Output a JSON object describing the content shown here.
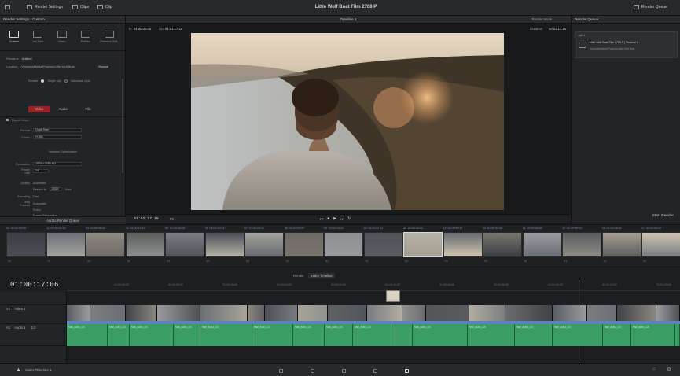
{
  "app": {
    "title": "Little Wolf Boat Film 2768 P",
    "menu": [
      {
        "label": "Render Settings",
        "icon": "render-settings-icon"
      },
      {
        "label": "Clips",
        "icon": "clips-icon"
      },
      {
        "label": "Clip",
        "icon": "inspector-icon"
      }
    ],
    "right_action": "Render Queue"
  },
  "render_settings": {
    "header": "Render Settings - Custom",
    "presets": [
      "Custom",
      "YouTube",
      "Vimeo",
      "ProRes",
      "Premiere XML"
    ],
    "filename_label": "Filename",
    "filename_value": "Untitled",
    "location_label": "Location",
    "location_value": "/Volumes/Media/Projects/Little Wolf Boat",
    "browse_label": "Browse",
    "render_label": "Render",
    "single_clip_label": "Single clip",
    "individual_clips_label": "Individual clips",
    "tabs": [
      "Video",
      "Audio",
      "File"
    ],
    "export_video_label": "Export Video",
    "format_label": "Format",
    "format_value": "QuickTime",
    "codec_label": "Codec",
    "codec_value": "H.264",
    "advanced_label": "Network Optimization",
    "resolution_label": "Resolution",
    "resolution_value": "1920 x 1080 HD",
    "framerate_label": "Frame rate",
    "framerate_value": "24",
    "quality_label": "Quality",
    "quality_auto": "Automatic",
    "quality_restrict": "Restrict to",
    "quality_value": "10000",
    "quality_unit": "Kb/s",
    "encoding_label": "Encoding",
    "encoding_value": "Fast",
    "keyframes_label": "Key Frames",
    "keyframes_auto": "Automatic",
    "keyframes_every": "Every",
    "frame_reordering": "Frame Reordering",
    "render_button": "Add to Render Queue"
  },
  "viewer": {
    "tab": "Timeline 1",
    "in_label": "In",
    "in_value": "01:00:00:00",
    "out_label": "Out",
    "out_value": "01:01:17:15",
    "render_mode": "Render Mode",
    "duration_label": "Duration",
    "duration_value": "00:01:17:15",
    "timecode": "01:02:17:16",
    "zoom": "Fit"
  },
  "render_queue": {
    "header": "Render Queue",
    "job_label": "Job 1",
    "job_title": "Little Wolf Boat Film 2768 P | Timeline 1",
    "job_path": "/Volumes/Media/Projects/Little Wolf Boat",
    "start_button": "Start Render"
  },
  "clips": {
    "items": [
      {
        "num": "01",
        "tc": "01:00:00:00",
        "label": "V1"
      },
      {
        "num": "02",
        "tc": "01:00:04:18",
        "label": "V1"
      },
      {
        "num": "03",
        "tc": "01:00:08:02",
        "label": "V1"
      },
      {
        "num": "04",
        "tc": "01:00:12:10",
        "label": "V1"
      },
      {
        "num": "05",
        "tc": "01:00:16:05",
        "label": "V1"
      },
      {
        "num": "06",
        "tc": "01:00:20:14",
        "label": "V1"
      },
      {
        "num": "07",
        "tc": "01:00:25:01",
        "label": "V1"
      },
      {
        "num": "08",
        "tc": "01:00:29:09",
        "label": "V1"
      },
      {
        "num": "09",
        "tc": "01:00:33:22",
        "label": "V1"
      },
      {
        "num": "10",
        "tc": "01:00:37:11",
        "label": "V1"
      },
      {
        "num": "11",
        "tc": "01:00:42:03",
        "label": "V1"
      },
      {
        "num": "12",
        "tc": "01:00:46:17",
        "label": "V1"
      },
      {
        "num": "13",
        "tc": "01:00:51:00",
        "label": "V1"
      },
      {
        "num": "14",
        "tc": "01:00:55:08",
        "label": "V1"
      },
      {
        "num": "15",
        "tc": "01:00:59:19",
        "label": "V1"
      },
      {
        "num": "16",
        "tc": "01:01:04:02",
        "label": "V1"
      },
      {
        "num": "17",
        "tc": "01:01:08:12",
        "label": "V1"
      }
    ]
  },
  "timeline": {
    "timecode": "01:00:17:06",
    "render_label": "Render",
    "render_value": "Entire Timeline",
    "ruler": [
      "01:00:00:00",
      "01:00:08:00",
      "01:00:16:00",
      "01:00:24:00",
      "01:00:32:00",
      "01:00:40:00",
      "01:00:48:00",
      "01:00:56:00",
      "01:01:04:00",
      "01:01:12:00",
      "01:01:20:00"
    ],
    "v1_label": "V1",
    "v1_name": "Video 1",
    "a1_label": "A1",
    "a1_name": "Audio 1",
    "a1_level": "2.0",
    "audio_clip_label": "MW_A001_C0"
  },
  "bottom": {
    "project_name": "Sales Timeline 1",
    "pages": [
      "Media",
      "Edit",
      "Fusion",
      "Color",
      "Deliver"
    ],
    "active_page": "Deliver"
  }
}
